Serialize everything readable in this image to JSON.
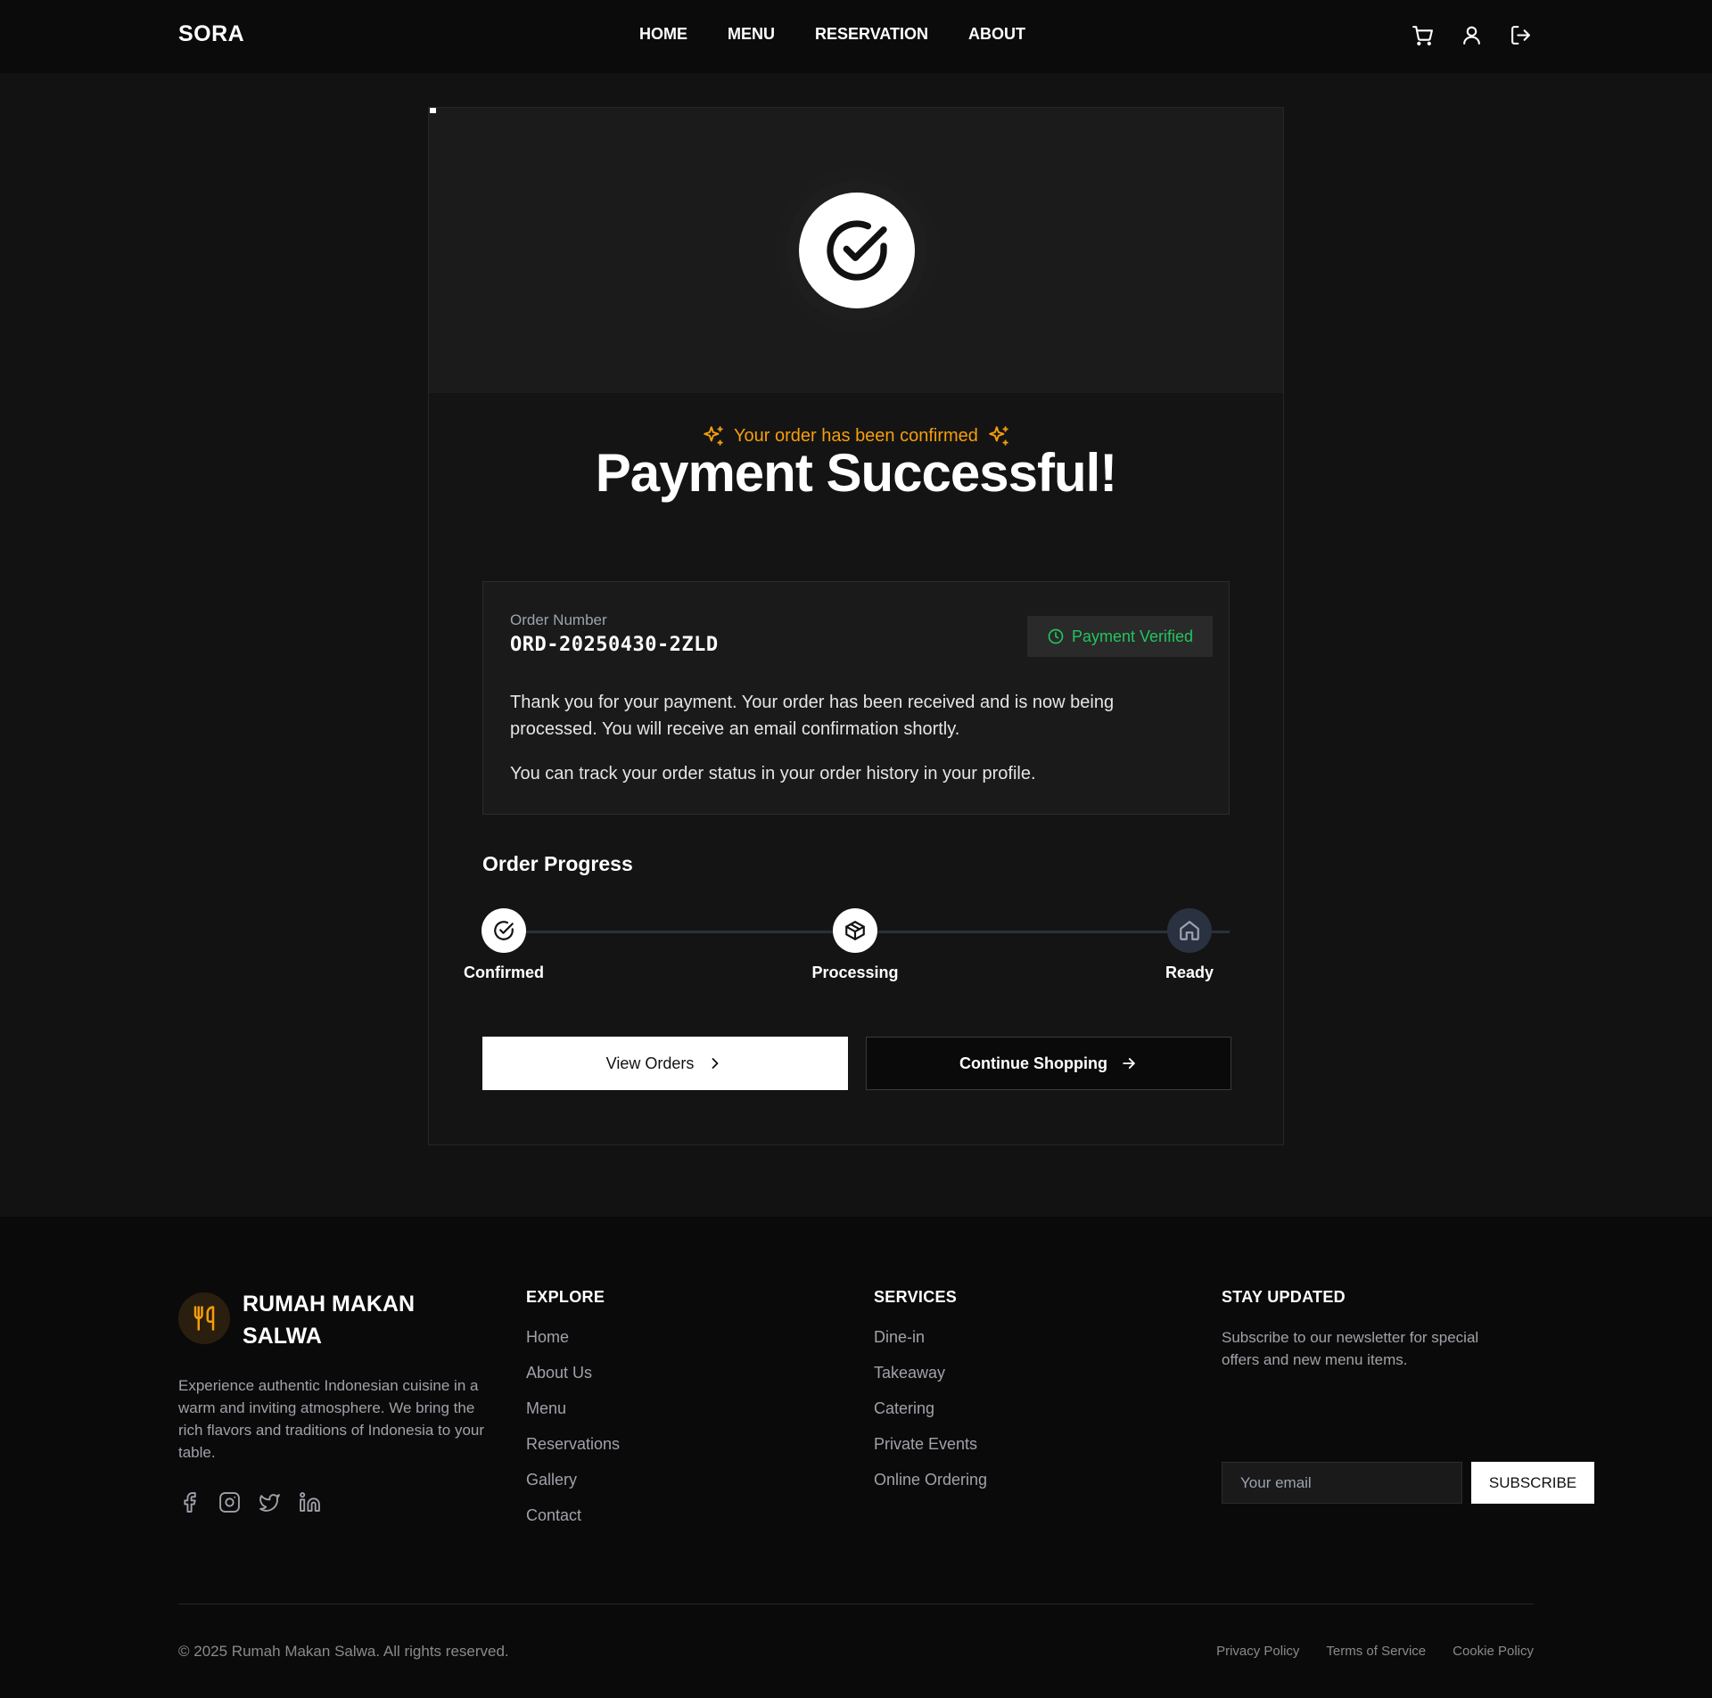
{
  "nav": {
    "brand": "SORA",
    "links": [
      "HOME",
      "MENU",
      "RESERVATION",
      "ABOUT"
    ],
    "icons": [
      "cart-icon",
      "user-icon",
      "logout-icon"
    ]
  },
  "card": {
    "headline": "Payment Successful!",
    "subline": "Your order has been confirmed",
    "order_label": "Order Number",
    "order_number": "ORD-20250430-2ZLD",
    "badge": "Payment Verified",
    "message1": "Thank you for your payment. Your order has been received and is now being processed. You will receive an email confirmation shortly.",
    "message2": "You can track your order status in your order history in your profile.",
    "progress_title": "Order Progress",
    "steps": [
      {
        "label": "Confirmed",
        "icon": "check-circle-icon",
        "state": "done"
      },
      {
        "label": "Processing",
        "icon": "package-icon",
        "state": "done"
      },
      {
        "label": "Ready",
        "icon": "home-icon",
        "state": "pending"
      }
    ],
    "view_orders": "View Orders",
    "continue_shopping": "Continue Shopping"
  },
  "footer": {
    "name": "RUMAH MAKAN SALWA",
    "description": "Experience authentic Indonesian cuisine in a warm and inviting atmosphere. We bring the rich flavors and traditions of Indonesia to your table.",
    "social": [
      "facebook-icon",
      "instagram-icon",
      "twitter-icon",
      "linkedin-icon"
    ],
    "explore": {
      "title": "EXPLORE",
      "links": [
        "Home",
        "About Us",
        "Menu",
        "Reservations",
        "Gallery",
        "Contact"
      ]
    },
    "services": {
      "title": "SERVICES",
      "links": [
        "Dine-in",
        "Takeaway",
        "Catering",
        "Private Events",
        "Online Ordering"
      ]
    },
    "newsletter": {
      "title": "STAY UPDATED",
      "description": "Subscribe to our newsletter for special offers and new menu items.",
      "placeholder": "Your email",
      "button": "SUBSCRIBE"
    },
    "copyright": "© 2025 Rumah Makan Salwa. All rights reserved.",
    "legal": [
      "Privacy Policy",
      "Terms of Service",
      "Cookie Policy"
    ]
  },
  "colors": {
    "accent_orange": "#f59e0b",
    "success_green": "#22c55e",
    "background": "#121212"
  }
}
